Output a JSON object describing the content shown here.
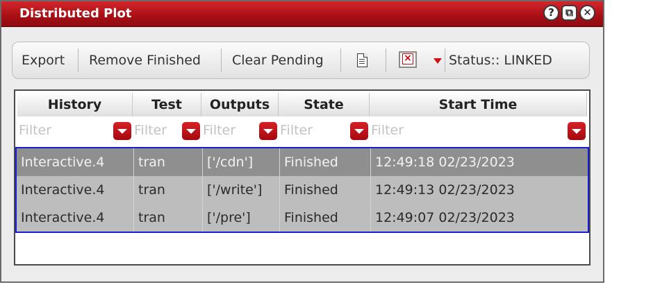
{
  "window": {
    "title": "Distributed Plot"
  },
  "title_buttons": {
    "help": "?",
    "restore": "⧉",
    "close": "✕"
  },
  "toolbar": {
    "export_label": "Export",
    "remove_finished_label": "Remove Finished",
    "clear_pending_label": "Clear Pending",
    "document_icon": "document-icon",
    "clear_icon": "red-x-icon",
    "status_text": "Status:: LINKED"
  },
  "table": {
    "headers": [
      "History",
      "Test",
      "Outputs",
      "State",
      "Start Time"
    ],
    "filter_placeholder": "Filter",
    "rows": [
      {
        "history": "Interactive.4",
        "test": "tran",
        "outputs": "['/cdn']",
        "state": "Finished",
        "start_time": "12:49:18 02/23/2023",
        "selected": true
      },
      {
        "history": "Interactive.4",
        "test": "tran",
        "outputs": "['/write']",
        "state": "Finished",
        "start_time": "12:49:13 02/23/2023",
        "selected": false
      },
      {
        "history": "Interactive.4",
        "test": "tran",
        "outputs": "['/pre']",
        "state": "Finished",
        "start_time": "12:49:07 02/23/2023",
        "selected": false
      }
    ]
  },
  "colors": {
    "title_bar": "#b5151a",
    "dropdown_button": "#c3141b",
    "selection_border": "#1a1ad6",
    "selected_row": "#8f8f8f",
    "row_background": "#bdbdbd"
  }
}
